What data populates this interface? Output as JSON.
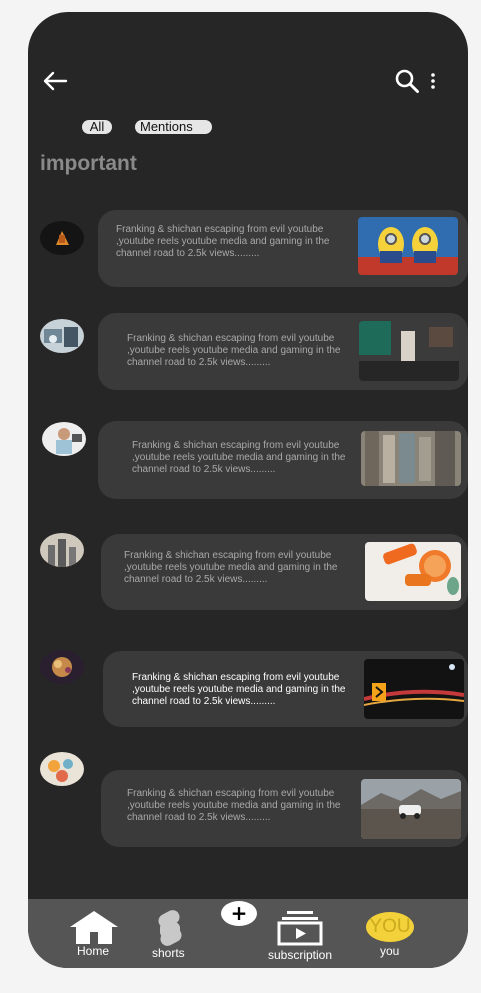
{
  "header": {
    "back_icon": "arrow-left-icon",
    "search_icon": "search-icon",
    "more_icon": "more-vertical-icon"
  },
  "filters": [
    {
      "label": "All"
    },
    {
      "label": "Mentions"
    }
  ],
  "section_title": "important",
  "notifications": [
    {
      "text": "Franking & shichan escaping from evil youtube ,youtube reels youtube media and gaming in the channel road to 2.5k views........."
    },
    {
      "text": "Franking & shichan escaping from evil youtube ,youtube reels youtube media and gaming in the channel road to 2.5k views........."
    },
    {
      "text": "Franking & shichan escaping from evil youtube ,youtube reels youtube media and gaming in the channel road to 2.5k views........."
    },
    {
      "text": "Franking & shichan escaping from evil youtube ,youtube reels youtube media and gaming in the channel road to 2.5k views........."
    },
    {
      "text": "Franking & shichan escaping from evil youtube ,youtube reels youtube media and gaming in the channel road to 2.5k views........."
    },
    {
      "text": "Franking & shichan escaping from evil youtube ,youtube reels youtube media and gaming in the channel road to 2.5k views........."
    }
  ],
  "nav": {
    "home": "Home",
    "shorts": "shorts",
    "create": "+",
    "subscription": "subscription",
    "you_badge": "YOU",
    "you": "you"
  },
  "colors": {
    "background": "#262626",
    "card": "#3a3a3a",
    "navbar": "#555555",
    "you_badge": "#f2d13a"
  }
}
